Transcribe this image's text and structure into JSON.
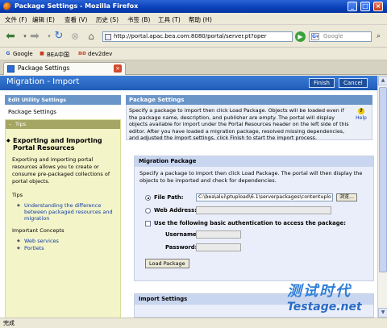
{
  "window": {
    "title": "Package Settings - Mozilla Firefox"
  },
  "menu": [
    "文件 (F)",
    "编辑 (E)",
    "查看 (V)",
    "历史 (S)",
    "书签 (B)",
    "工具 (T)",
    "帮助 (H)"
  ],
  "nav": {
    "url": "http://portal.apac.bea.com:8080/portal/server.pt?oper",
    "search_placeholder": "Google"
  },
  "bookmarks": [
    "Google",
    "BEA中国",
    "dev2dev"
  ],
  "tab": {
    "label": "Package Settings"
  },
  "portal": {
    "title": "Migration - Import",
    "finish_label": "Finish",
    "cancel_label": "Cancel"
  },
  "left": {
    "edit_header": "Edit Utility Settings",
    "edit_item": "Package Settings",
    "tips_header": "Tips",
    "tips_title": "Exporting and Importing Portal Resources",
    "tips_text": "Exporting and importing portal resources allows you to create or consume pre-packaged collections of portal objects.",
    "tips_label": "Tips",
    "tips_links": [
      "Understanding the difference between packaged resources and migration"
    ],
    "concepts_label": "Important Concepts",
    "concept_links": [
      "Web services",
      "Portlets"
    ]
  },
  "right": {
    "header": "Package Settings",
    "intro": "Specify a package to import then click Load Package. Objects will be loaded even if the package name, description, and publisher are empty. The portal will display objects available for import under the Portal Resources header on the left side of this editor. After you have loaded a migration package, resolved missing dependencies, and adjusted the import settings, click Finish to start the import process.",
    "help_label": "Help",
    "migration": {
      "header": "Migration Package",
      "desc": "Specify a package to import then click Load Package. The portal will then display the objects to be imported and check for dependencies.",
      "file_path_label": "File Path:",
      "file_path_value": "C:\\bea\\alui\\ptupload\\6.1\\serverpackages\\contentuplo",
      "browse_label": "浏览...",
      "web_address_label": "Web Address:",
      "auth_label": "Use the following basic authentication to access the package:",
      "username_label": "Username:",
      "password_label": "Password:",
      "load_label": "Load Package"
    },
    "import_header": "Import Settings"
  },
  "watermark": {
    "line1": "测试时代",
    "line2": "Testage.net"
  },
  "status": "完成"
}
